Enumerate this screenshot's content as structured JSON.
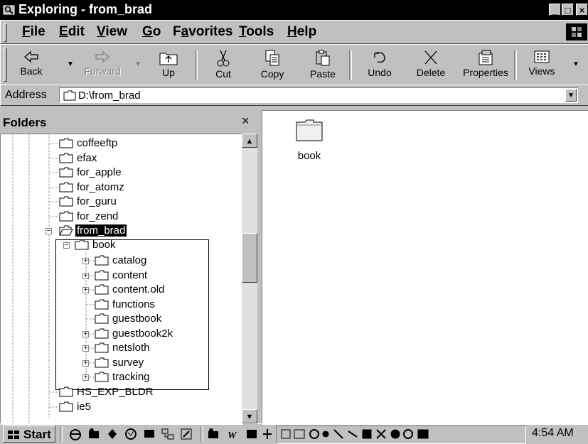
{
  "window": {
    "title": "Exploring - from_brad",
    "min": "_",
    "max": "□",
    "close": "×"
  },
  "menu": {
    "items": [
      {
        "label": "File",
        "mnemonic_index": 0
      },
      {
        "label": "Edit",
        "mnemonic_index": 0
      },
      {
        "label": "View",
        "mnemonic_index": 0
      },
      {
        "label": "Go",
        "mnemonic_index": 0
      },
      {
        "label": "Favorites",
        "mnemonic_index": 1
      },
      {
        "label": "Tools",
        "mnemonic_index": 0
      },
      {
        "label": "Help",
        "mnemonic_index": 0
      }
    ]
  },
  "toolbar": {
    "back": "Back",
    "forward": "Forward",
    "up": "Up",
    "cut": "Cut",
    "copy": "Copy",
    "paste": "Paste",
    "undo": "Undo",
    "delete": "Delete",
    "properties": "Properties",
    "views": "Views"
  },
  "address": {
    "label": "Address",
    "value": "D:\\from_brad"
  },
  "folders": {
    "title": "Folders",
    "close": "×",
    "tree": [
      {
        "label": "coffeeftp",
        "level": 0,
        "expander": "",
        "selected": false
      },
      {
        "label": "efax",
        "level": 0,
        "expander": "",
        "selected": false
      },
      {
        "label": "for_apple",
        "level": 0,
        "expander": "",
        "selected": false
      },
      {
        "label": "for_atomz",
        "level": 0,
        "expander": "",
        "selected": false
      },
      {
        "label": "for_guru",
        "level": 0,
        "expander": "",
        "selected": false
      },
      {
        "label": "for_zend",
        "level": 0,
        "expander": "",
        "selected": false
      },
      {
        "label": "from_brad",
        "level": 0,
        "expander": "-",
        "selected": true,
        "open": true
      },
      {
        "label": "book",
        "level": 1,
        "expander": "-",
        "selected": false
      },
      {
        "label": "catalog",
        "level": 2,
        "expander": "+",
        "selected": false
      },
      {
        "label": "content",
        "level": 2,
        "expander": "+",
        "selected": false
      },
      {
        "label": "content.old",
        "level": 2,
        "expander": "+",
        "selected": false
      },
      {
        "label": "functions",
        "level": 2,
        "expander": "",
        "selected": false
      },
      {
        "label": "guestbook",
        "level": 2,
        "expander": "",
        "selected": false
      },
      {
        "label": "guestbook2k",
        "level": 2,
        "expander": "+",
        "selected": false
      },
      {
        "label": "netsloth",
        "level": 2,
        "expander": "+",
        "selected": false
      },
      {
        "label": "survey",
        "level": 2,
        "expander": "+",
        "selected": false
      },
      {
        "label": "tracking",
        "level": 2,
        "expander": "+",
        "selected": false
      },
      {
        "label": "HS_EXP_BLDR",
        "level": 0,
        "expander": "",
        "selected": false
      },
      {
        "label": "ie5",
        "level": 0,
        "expander": "",
        "selected": false
      }
    ]
  },
  "contents": {
    "items": [
      {
        "label": "book",
        "icon": "folder-icon"
      }
    ]
  },
  "taskbar": {
    "start": "Start",
    "clock": "4:54 AM"
  },
  "colors": {
    "titlebar": "#000000",
    "chrome": "#c0c0c0",
    "window_bg": "#ffffff",
    "selection": "#000000"
  }
}
